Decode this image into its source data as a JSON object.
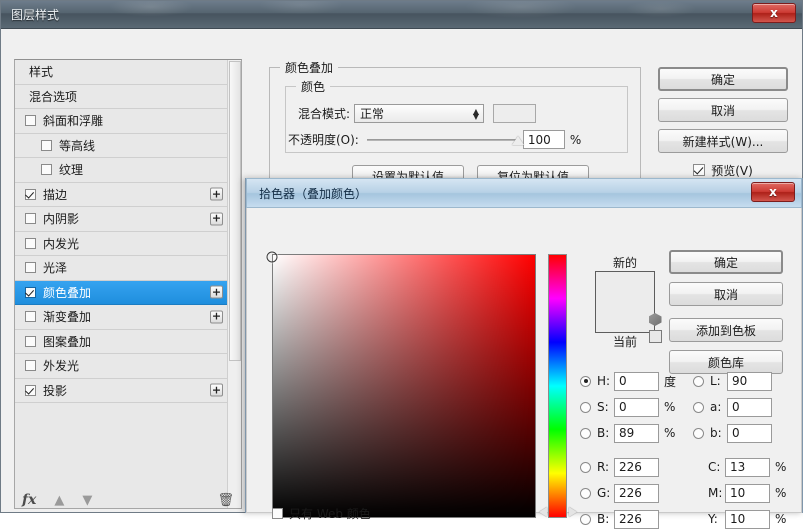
{
  "window": {
    "title": "图层样式",
    "close_label": "x"
  },
  "styles_panel": {
    "items": [
      {
        "label": "样式",
        "type": "plain",
        "checkbox": false,
        "checked": false,
        "plus": false,
        "indent": false,
        "selected": false
      },
      {
        "label": "混合选项",
        "type": "plain",
        "checkbox": false,
        "checked": false,
        "plus": false,
        "indent": false,
        "selected": false
      },
      {
        "label": "斜面和浮雕",
        "type": "check",
        "checkbox": true,
        "checked": false,
        "plus": false,
        "indent": false,
        "selected": false
      },
      {
        "label": "等高线",
        "type": "check",
        "checkbox": true,
        "checked": false,
        "plus": false,
        "indent": true,
        "selected": false
      },
      {
        "label": "纹理",
        "type": "check",
        "checkbox": true,
        "checked": false,
        "plus": false,
        "indent": true,
        "selected": false
      },
      {
        "label": "描边",
        "type": "check",
        "checkbox": true,
        "checked": true,
        "plus": true,
        "indent": false,
        "selected": false
      },
      {
        "label": "内阴影",
        "type": "check",
        "checkbox": true,
        "checked": false,
        "plus": true,
        "indent": false,
        "selected": false
      },
      {
        "label": "内发光",
        "type": "check",
        "checkbox": true,
        "checked": false,
        "plus": false,
        "indent": false,
        "selected": false
      },
      {
        "label": "光泽",
        "type": "check",
        "checkbox": true,
        "checked": false,
        "plus": false,
        "indent": false,
        "selected": false
      },
      {
        "label": "颜色叠加",
        "type": "check",
        "checkbox": true,
        "checked": true,
        "plus": true,
        "indent": false,
        "selected": true
      },
      {
        "label": "渐变叠加",
        "type": "check",
        "checkbox": true,
        "checked": false,
        "plus": true,
        "indent": false,
        "selected": false
      },
      {
        "label": "图案叠加",
        "type": "check",
        "checkbox": true,
        "checked": false,
        "plus": false,
        "indent": false,
        "selected": false
      },
      {
        "label": "外发光",
        "type": "check",
        "checkbox": true,
        "checked": false,
        "plus": false,
        "indent": false,
        "selected": false
      },
      {
        "label": "投影",
        "type": "check",
        "checkbox": true,
        "checked": true,
        "plus": true,
        "indent": false,
        "selected": false
      }
    ]
  },
  "fx_toolbar": {
    "fx_label": "fx",
    "up_arrow": "▲",
    "down_arrow": "▼",
    "trash": "🗑"
  },
  "color_overlay": {
    "group_title": "颜色叠加",
    "sub_title": "颜色",
    "blend_mode_label": "混合模式:",
    "blend_mode_value": "正常",
    "opacity_label": "不透明度(O):",
    "opacity_value": "100",
    "opacity_unit": "%",
    "set_default_label": "设置为默认值",
    "reset_default_label": "复位为默认值"
  },
  "right_buttons": {
    "ok": "确定",
    "cancel": "取消",
    "new_style": "新建样式(W)...",
    "preview": "预览(V)"
  },
  "color_picker": {
    "title": "拾色器（叠加颜色）",
    "close_label": "x",
    "new_label": "新的",
    "current_label": "当前",
    "buttons": {
      "ok": "确定",
      "cancel": "取消",
      "add_to_swatches": "添加到色板",
      "color_libraries": "颜色库"
    },
    "values": {
      "h_label": "H:",
      "h_value": "0",
      "h_unit": "度",
      "h_selected": true,
      "s_label": "S:",
      "s_value": "0",
      "s_unit": "%",
      "s_selected": false,
      "b_label": "B:",
      "b_value": "89",
      "b_unit": "%",
      "b_selected": false,
      "l_label": "L:",
      "l_value": "90",
      "l_unit": "",
      "l_selected": false,
      "a_label": "a:",
      "a_value": "0",
      "a_unit": "",
      "a_selected": false,
      "blab_label": "b:",
      "blab_value": "0",
      "blab_unit": "",
      "blab_selected": false,
      "r_label": "R:",
      "r_value": "226",
      "r_unit": "",
      "r_selected": false,
      "g_label": "G:",
      "g_value": "226",
      "g_unit": "",
      "g_selected": false,
      "bb_label": "B:",
      "bb_value": "226",
      "bb_unit": "",
      "bb_selected": false,
      "c_label": "C:",
      "c_value": "13",
      "c_unit": "%",
      "m_label": "M:",
      "m_value": "10",
      "m_unit": "%",
      "y_label": "Y:",
      "y_value": "10",
      "y_unit": "%"
    },
    "web_only_label": "只有 Web 颜色"
  },
  "colors": {
    "selection_blue": "#1f8edd",
    "title_dark": "#55646f",
    "close_red": "#cc3a33",
    "picker_title_blue": "#b7d1e6",
    "hue_base": "#ff0000",
    "dialog_bg": "#f0f0f0"
  }
}
